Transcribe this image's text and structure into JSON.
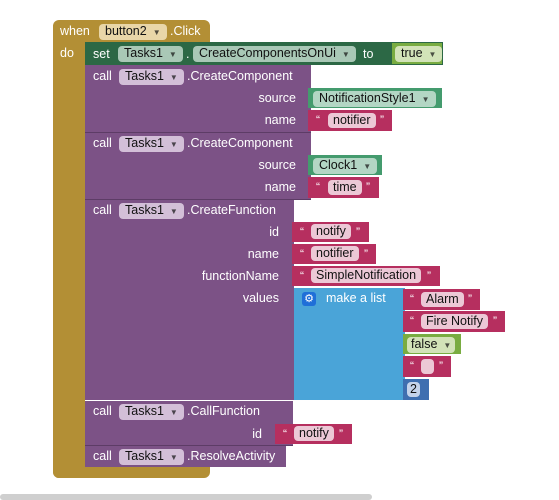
{
  "event": {
    "when": "when",
    "component": "button2",
    "event": ".Click",
    "do": "do"
  },
  "set": {
    "label": "set",
    "component": "Tasks1",
    "dot": ".",
    "property": "CreateComponentsOnUi",
    "to": "to",
    "value": "true"
  },
  "create1": {
    "call": "call",
    "component": "Tasks1",
    "method": ".CreateComponent",
    "source_label": "source",
    "source": "NotificationStyle1",
    "name_label": "name",
    "name": "notifier"
  },
  "create2": {
    "call": "call",
    "component": "Tasks1",
    "method": ".CreateComponent",
    "source_label": "source",
    "source": "Clock1",
    "name_label": "name",
    "name": "time"
  },
  "func": {
    "call": "call",
    "component": "Tasks1",
    "method": ".CreateFunction",
    "id_label": "id",
    "id": "notify",
    "name_label": "name",
    "name": "notifier",
    "fn_label": "functionName",
    "fn": "SimpleNotification",
    "values_label": "values",
    "list": {
      "label": "make a list",
      "items": [
        "Alarm",
        "Fire Notify",
        "false",
        "",
        "2"
      ]
    }
  },
  "callfn": {
    "call": "call",
    "component": "Tasks1",
    "method": ".CallFunction",
    "id_label": "id",
    "id": "notify"
  },
  "resolve": {
    "call": "call",
    "component": "Tasks1",
    "method": ".ResolveActivity"
  },
  "quote_open": "“",
  "quote_close": "”"
}
